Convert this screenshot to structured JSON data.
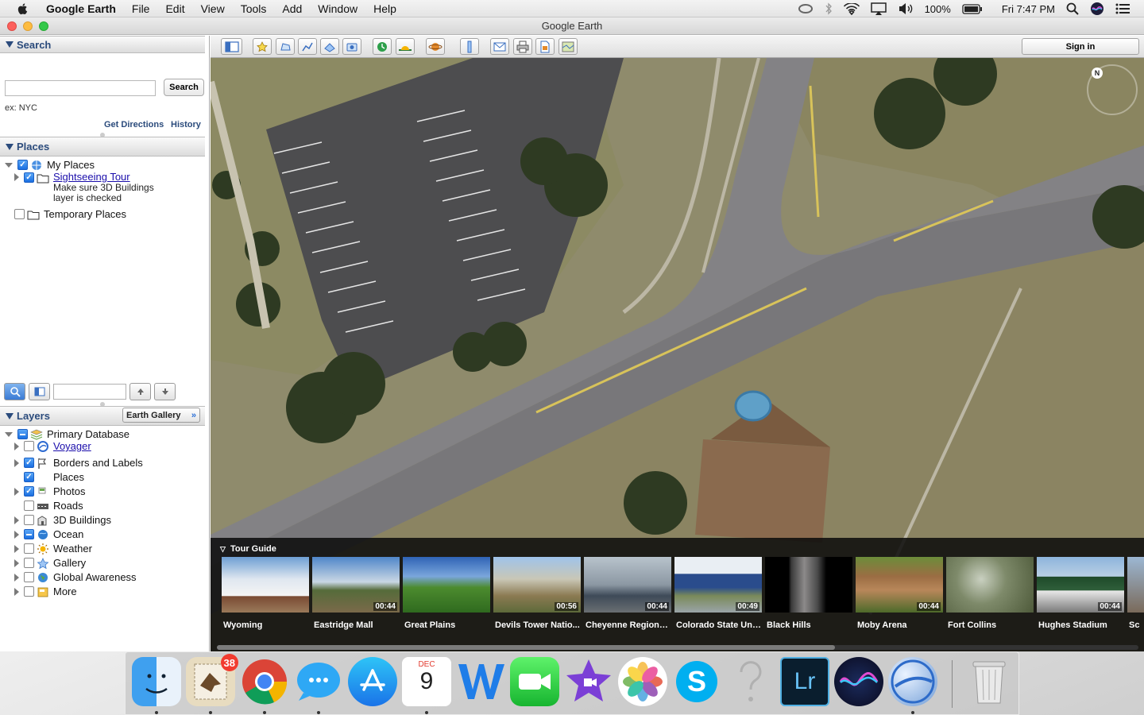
{
  "menubar": {
    "app_name": "Google Earth",
    "menus": [
      "File",
      "Edit",
      "View",
      "Tools",
      "Add",
      "Window",
      "Help"
    ],
    "battery": "100%",
    "clock": "Fri 7:47 PM"
  },
  "window": {
    "title": "Google Earth"
  },
  "search_panel": {
    "header": "Search",
    "button": "Search",
    "input_value": "",
    "hint": "ex: NYC",
    "get_directions": "Get Directions",
    "history": "History"
  },
  "places_panel": {
    "header": "Places",
    "my_places": "My Places",
    "sightseeing_tour": "Sightseeing Tour",
    "sightseeing_desc_1": "Make sure 3D Buildings",
    "sightseeing_desc_2": "layer is checked",
    "temporary_places": "Temporary Places"
  },
  "layers_panel": {
    "header": "Layers",
    "earth_gallery": "Earth Gallery",
    "items": [
      {
        "label": "Primary Database",
        "state": "partial"
      },
      {
        "label": "Voyager",
        "state": "off"
      },
      {
        "label": "Borders and Labels",
        "state": "on"
      },
      {
        "label": "Places",
        "state": "on"
      },
      {
        "label": "Photos",
        "state": "on"
      },
      {
        "label": "Roads",
        "state": "off"
      },
      {
        "label": "3D Buildings",
        "state": "off"
      },
      {
        "label": "Ocean",
        "state": "partial"
      },
      {
        "label": "Weather",
        "state": "off"
      },
      {
        "label": "Gallery",
        "state": "off"
      },
      {
        "label": "Global Awareness",
        "state": "off"
      },
      {
        "label": "More",
        "state": "off"
      }
    ]
  },
  "toolbar": {
    "sign_in": "Sign in"
  },
  "map": {
    "compass_label": "N"
  },
  "tour_guide": {
    "title": "Tour Guide",
    "items": [
      {
        "label": "Wyoming",
        "duration": ""
      },
      {
        "label": "Eastridge Mall",
        "duration": "00:44"
      },
      {
        "label": "Great Plains",
        "duration": ""
      },
      {
        "label": "Devils Tower Natio...",
        "duration": "00:56"
      },
      {
        "label": "Cheyenne Regiona...",
        "duration": "00:44"
      },
      {
        "label": "Colorado State Uni...",
        "duration": "00:49"
      },
      {
        "label": "Black Hills",
        "duration": ""
      },
      {
        "label": "Moby Arena",
        "duration": "00:44"
      },
      {
        "label": "Fort Collins",
        "duration": ""
      },
      {
        "label": "Hughes Stadium",
        "duration": "00:44"
      },
      {
        "label": "Sc",
        "duration": ""
      }
    ]
  },
  "dock": {
    "apps": [
      "Finder",
      "Mail",
      "Chrome",
      "Messages",
      "App Store",
      "Calendar",
      "Word",
      "FaceTime",
      "iMovie",
      "Photos",
      "Skype",
      "Help",
      "Lightroom",
      "Siri",
      "Google Earth",
      "Trash"
    ],
    "mail_badge": "38",
    "calendar_month": "DEC",
    "calendar_day": "9",
    "lightroom_label": "Lr"
  },
  "colors": {
    "panel_header_text": "#2b4b7c",
    "checkbox_blue": "#1b6fe1",
    "link_blue": "#1a0dab"
  }
}
